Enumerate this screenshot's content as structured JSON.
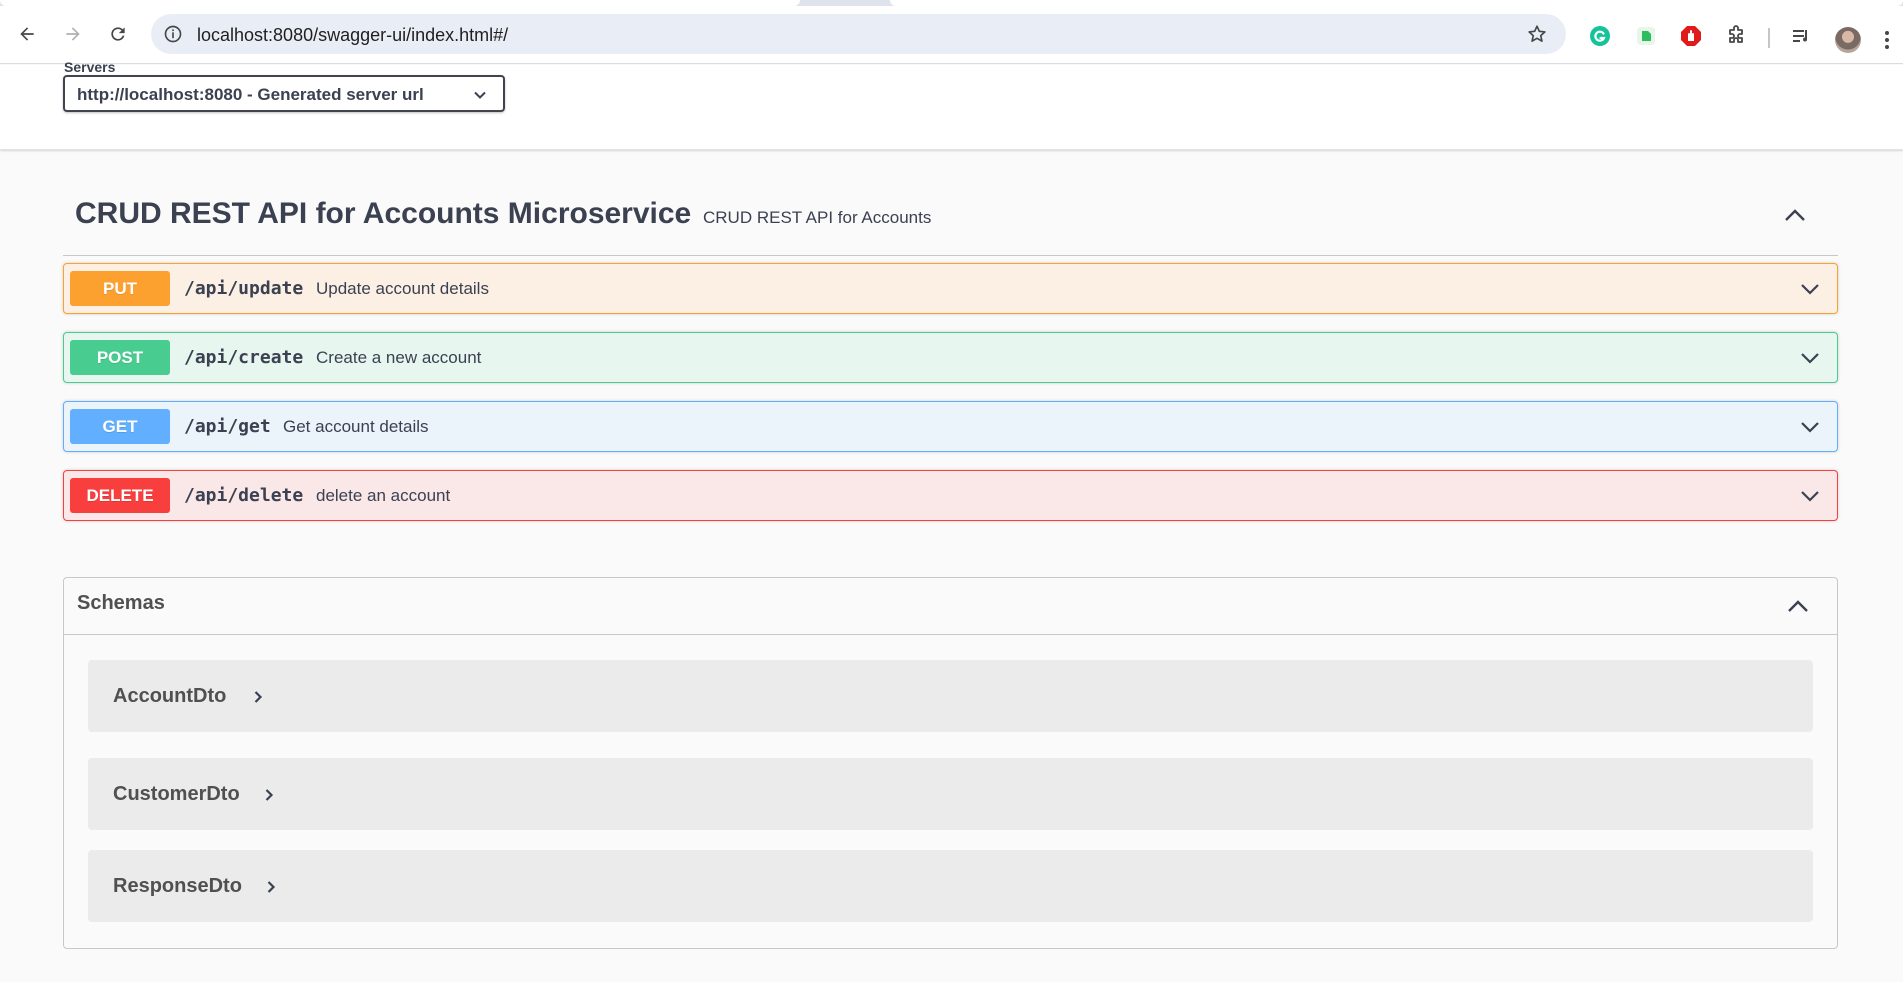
{
  "browser": {
    "url": "localhost:8080/swagger-ui/index.html#/"
  },
  "servers": {
    "title": "Servers",
    "selected": "http://localhost:8080 - Generated server url"
  },
  "tag": {
    "name": "CRUD REST API for Accounts Microservice",
    "description": "CRUD REST API for Accounts"
  },
  "operations": [
    {
      "method": "PUT",
      "path": "/api/update",
      "summary": "Update account details",
      "color": "#fca130"
    },
    {
      "method": "POST",
      "path": "/api/create",
      "summary": "Create a new account",
      "color": "#49cc90"
    },
    {
      "method": "GET",
      "path": "/api/get",
      "summary": "Get account details",
      "color": "#61affe"
    },
    {
      "method": "DELETE",
      "path": "/api/delete",
      "summary": "delete an account",
      "color": "#f93e3e"
    }
  ],
  "schemas": {
    "title": "Schemas",
    "models": [
      "AccountDto",
      "CustomerDto",
      "ResponseDto"
    ]
  }
}
